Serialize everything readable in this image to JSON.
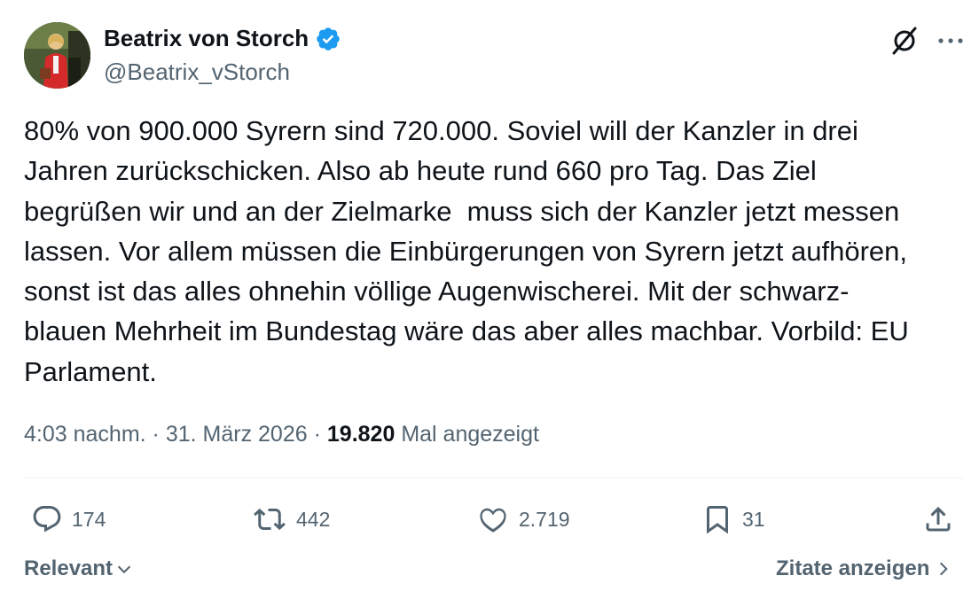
{
  "author": {
    "name": "Beatrix von Storch",
    "handle": "@Beatrix_vStorch",
    "verified": true
  },
  "tweet": {
    "text": "80% von 900.000 Syrern sind 720.000. Soviel will der Kanzler in drei\nJahren zurückschicken. Also ab heute rund 660 pro Tag. Das Ziel\nbegrüßen wir und an der Zielmarke  muss sich der Kanzler jetzt messen\nlassen. Vor allem müssen die Einbürgerungen von Syrern jetzt aufhören,\nsonst ist das alles ohnehin völlige Augenwischerei. Mit der schwarz-\nblauen Mehrheit im Bundestag wäre das aber alles machbar. Vorbild: EU\nParlament."
  },
  "meta": {
    "time": "4:03 nachm.",
    "separator": "·",
    "date": "31. März 2026",
    "views_count": "19.820",
    "views_label": "Mal angezeigt"
  },
  "actions": {
    "replies": {
      "icon": "reply-icon",
      "count": "174"
    },
    "reposts": {
      "icon": "repost-icon",
      "count": "442"
    },
    "likes": {
      "icon": "like-icon",
      "count": "2.719"
    },
    "bookmarks": {
      "icon": "bookmark-icon",
      "count": "31"
    },
    "share": {
      "icon": "share-icon"
    }
  },
  "footer": {
    "sort_label": "Relevant",
    "quotes_label": "Zitate anzeigen"
  },
  "colors": {
    "text": "#0f1419",
    "secondary": "#536471",
    "verified_blue": "#1d9bf0",
    "divider": "#eff3f4"
  },
  "icons": {
    "grok": "grok-icon",
    "more": "more-icon",
    "chevron_down": "chevron-down-icon",
    "chevron_right": "chevron-right-icon"
  }
}
